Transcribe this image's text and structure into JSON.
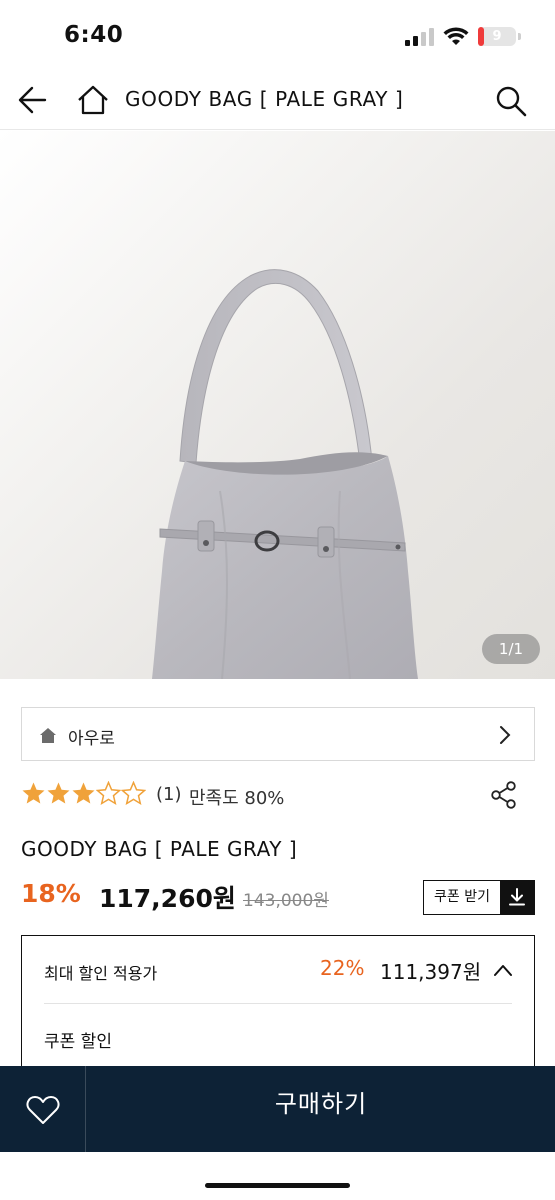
{
  "status_bar": {
    "time": "6:40",
    "battery_level": "9",
    "battery_fraction": 0.09,
    "battery_color": "#ef3b3b"
  },
  "header": {
    "title": "GOODY BAG [ PALE GRAY ]",
    "back_icon": "arrow-left",
    "home_icon": "home",
    "search_icon": "magnifier"
  },
  "gallery": {
    "counter": "1/1",
    "subject": "pale gray shoulder bag with belt strap"
  },
  "brand": {
    "name": "아우로",
    "icon": "home"
  },
  "rating": {
    "stars": 3,
    "max_stars": 5,
    "count": "(1)",
    "satisfaction": "만족도 80%",
    "star_color": "#f0a23a"
  },
  "product": {
    "title": "GOODY BAG [ PALE GRAY ]",
    "discount_rate": "18%",
    "sale_price": "117,260원",
    "original_price": "143,000원",
    "accent_color": "#e8641f"
  },
  "coupon_button": {
    "label": "쿠폰 받기",
    "icon": "download"
  },
  "discount_box": {
    "max_label": "최대 할인 적용가",
    "max_rate": "22%",
    "max_price": "111,397원",
    "coupon_label": "쿠폰 할인"
  },
  "bottom_bar": {
    "buy_label": "구매하기",
    "wish_icon": "heart",
    "background": "#0d2236"
  }
}
